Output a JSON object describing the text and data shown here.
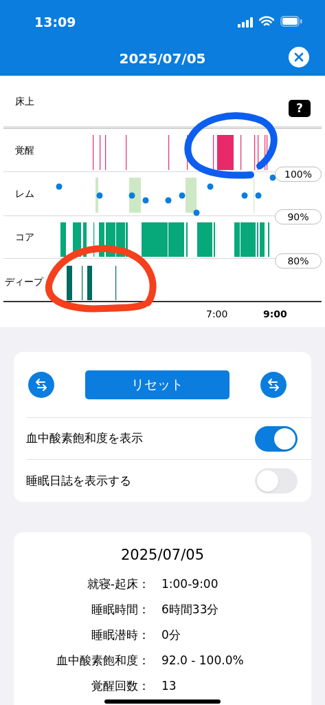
{
  "status_bar": {
    "time": "13:09"
  },
  "header": {
    "title": "2025/07/05"
  },
  "chart": {
    "help_label": "?",
    "stages": [
      {
        "label": "床上"
      },
      {
        "label": "覚醒"
      },
      {
        "label": "レム"
      },
      {
        "label": "コア"
      },
      {
        "label": "ディープ"
      }
    ],
    "spo2_labels": [
      "100%",
      "90%",
      "80%"
    ],
    "time_labels": [
      {
        "text": "7:00",
        "bold": false
      },
      {
        "text": "9:00",
        "bold": true
      }
    ]
  },
  "controls": {
    "reset_button": "リセット",
    "toggles": [
      {
        "label": "血中酸素飽和度を表示",
        "on": true
      },
      {
        "label": "睡眠日誌を表示する",
        "on": false
      }
    ]
  },
  "summary": {
    "title": "2025/07/05",
    "rows": [
      {
        "label": "就寝-起床：",
        "value": "1:00-9:00"
      },
      {
        "label": "睡眠時間：",
        "value": "6時間33分"
      },
      {
        "label": "睡眠潜時：",
        "value": "0分"
      },
      {
        "label": "血中酸素飽和度：",
        "value": "92.0 - 100.0%"
      },
      {
        "label": "覚醒回数：",
        "value": "13"
      }
    ]
  }
}
